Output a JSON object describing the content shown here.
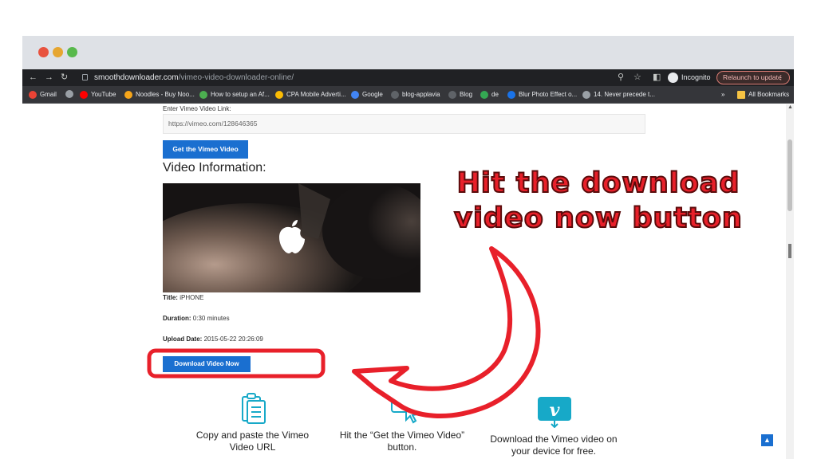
{
  "browser": {
    "url_host": "smoothdownloader.com",
    "url_path": "/vimeo-video-downloader-online/",
    "incognito_label": "Incognito",
    "relaunch_label": "Relaunch to update",
    "bookmarks": [
      {
        "label": "Gmail",
        "color": "#ea4335"
      },
      {
        "label": "",
        "color": "#9aa0a6"
      },
      {
        "label": "YouTube",
        "color": "#ff0000"
      },
      {
        "label": "Noodles - Buy Noo...",
        "color": "#f6a51a"
      },
      {
        "label": "How to setup an Af...",
        "color": "#4caf50"
      },
      {
        "label": "CPA Mobile Adverti...",
        "color": "#fbbc04"
      },
      {
        "label": "Google",
        "color": "#4285f4"
      },
      {
        "label": "blog-applavia",
        "color": "#5f6368"
      },
      {
        "label": "Blog",
        "color": "#5f6368"
      },
      {
        "label": "de",
        "color": "#34a853"
      },
      {
        "label": "Blur Photo Effect o...",
        "color": "#1a73e8"
      },
      {
        "label": "14. Never precede t...",
        "color": "#9aa0a6"
      }
    ],
    "more_label": "»",
    "all_bookmarks_label": "All Bookmarks"
  },
  "page": {
    "link_label": "Enter Vimeo Video Link:",
    "link_value": "https://vimeo.com/128646365",
    "get_button_label": "Get the Vimeo Video",
    "video_info_heading": "Video Information:",
    "title_label": "Title:",
    "title_value": "iPHONE",
    "duration_label": "Duration:",
    "duration_value": "0:30 minutes",
    "upload_label": "Upload Date:",
    "upload_value": "2015-05-22 20:26:09",
    "download_button_label": "Download Video Now",
    "features": [
      {
        "line1": "Copy and paste the Vimeo",
        "line2": "Video URL"
      },
      {
        "line1": "Hit the “Get the Vimeo Video”",
        "line2": "button."
      },
      {
        "line1": "Download the Vimeo video on",
        "line2": "your device for free."
      }
    ],
    "accent_color": "#1a6fd0"
  },
  "annotation": {
    "line1": "Hit the download",
    "line2": "video now button",
    "color": "#e8202a"
  }
}
